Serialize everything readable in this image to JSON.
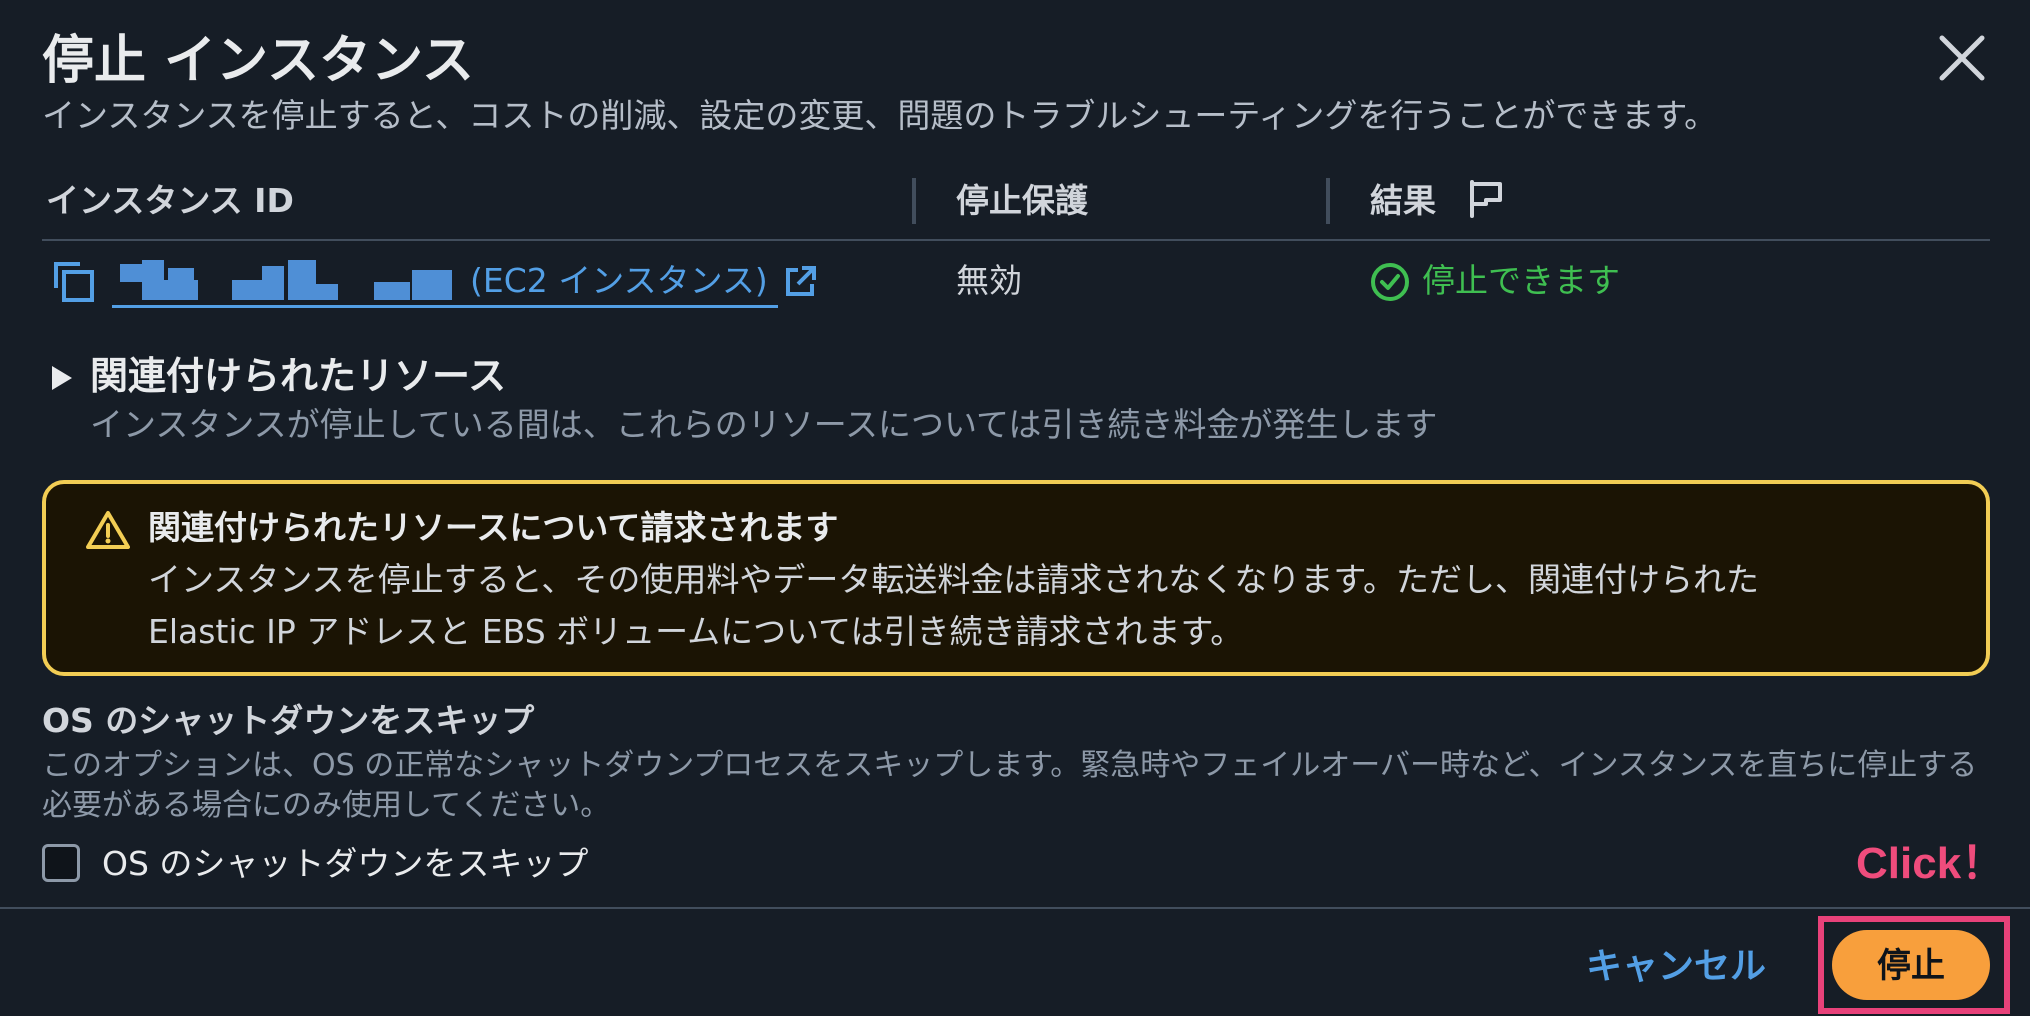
{
  "dialog": {
    "title": "停止 インスタンス",
    "subtitle": "インスタンスを停止すると、コストの削減、設定の変更、問題のトラブルシューティングを行うことができます。"
  },
  "table": {
    "columns": [
      "インスタンス ID",
      "停止保護",
      "結果"
    ],
    "rows": [
      {
        "instance_suffix": "(EC2 インスタンス)",
        "stop_protection": "無効",
        "result": "停止できます"
      }
    ]
  },
  "related_resources": {
    "title": "関連付けられたリソース",
    "description": "インスタンスが停止している間は、これらのリソースについては引き続き料金が発生します"
  },
  "alert": {
    "title": "関連付けられたリソースについて請求されます",
    "line1": "インスタンスを停止すると、その使用料やデータ転送料金は請求されなくなります。ただし、関連付けられた",
    "line2": "Elastic IP アドレスと EBS ボリュームについては引き続き請求されます。"
  },
  "os_skip": {
    "title": "OS のシャットダウンをスキップ",
    "description": "このオプションは、OS の正常なシャットダウンプロセスをスキップします。緊急時やフェイルオーバー時など、インスタンスを直ちに停止する必要がある場合にのみ使用してください。",
    "checkbox_label": "OS のシャットダウンをスキップ",
    "checked": false
  },
  "annotation": {
    "text": "Click！"
  },
  "footer": {
    "cancel_label": "キャンセル",
    "stop_label": "停止"
  },
  "icons": {
    "close": "close-icon",
    "flag": "flag-icon",
    "copy": "copy-icon",
    "external_link": "external-link-icon",
    "status": "check-circle-icon",
    "caret": "caret-right-icon",
    "warning": "warning-icon"
  },
  "colors": {
    "background": "#161d26",
    "link": "#539fe5",
    "success": "#3fbf51",
    "warning_border": "#f2cd54",
    "primary_button": "#f89f3c",
    "annotation": "#e8427a"
  }
}
